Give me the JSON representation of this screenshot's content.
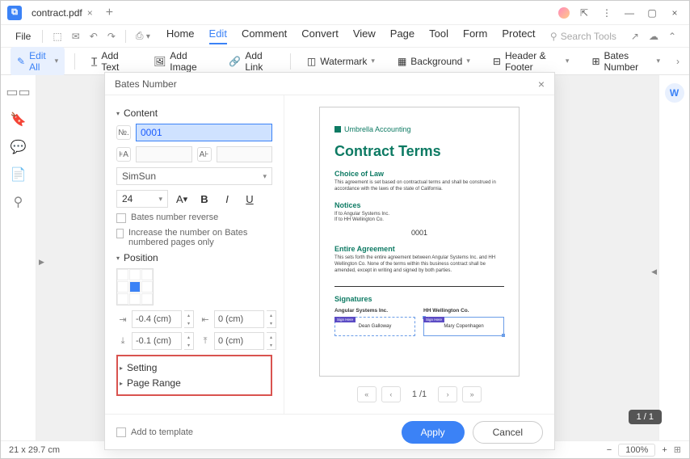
{
  "titlebar": {
    "filename": "contract.pdf"
  },
  "menu": {
    "file": "File",
    "tabs": [
      "Home",
      "Edit",
      "Comment",
      "Convert",
      "View",
      "Page",
      "Tool",
      "Form",
      "Protect"
    ],
    "active_tab": "Edit",
    "search_placeholder": "Search Tools"
  },
  "toolbar": {
    "edit_all": "Edit All",
    "add_text": "Add Text",
    "add_image": "Add Image",
    "add_link": "Add Link",
    "watermark": "Watermark",
    "background": "Background",
    "header_footer": "Header & Footer",
    "bates_number": "Bates Number"
  },
  "dialog": {
    "title": "Bates Number",
    "content_hdr": "Content",
    "number_value": "0001",
    "font_name": "SimSun",
    "font_size": "24",
    "reverse": "Bates number reverse",
    "increase": "Increase the number on Bates numbered pages only",
    "position_hdr": "Position",
    "off1": "-0.4 (cm)",
    "off2": "0 (cm)",
    "off3": "-0.1 (cm)",
    "off4": "0 (cm)",
    "setting_hdr": "Setting",
    "page_range_hdr": "Page Range",
    "add_to_template": "Add to template",
    "apply": "Apply",
    "cancel": "Cancel",
    "pager": "1 /1"
  },
  "preview": {
    "company": "Umbrella Accounting",
    "h1": "Contract Terms",
    "s1": "Choice of Law",
    "s1_body": "This agreement is set based on contractual terms and shall be construed in accordance with the laws of the state of California.",
    "s2": "Notices",
    "s2_l1": "If to Angular Systems Inc.",
    "s2_l2": "If to HH Wellington Co.",
    "bates": "0001",
    "s3": "Entire Agreement",
    "s3_body": "This sets forth the entire agreement between Angular Systems Inc. and HH Wellington Co. None of the terms within this business contract shall be amended, except in writing and signed by both parties.",
    "s4": "Signatures",
    "party1": "Angular Systems Inc.",
    "party2": "HH Wellington Co.",
    "sig1": "Dean Galloway",
    "sig2": "Mary Copenhagen",
    "sig_tag": "Sign Here"
  },
  "status": {
    "dims": "21 x 29.7 cm",
    "zoom": "100%",
    "page": "1 / 1"
  }
}
